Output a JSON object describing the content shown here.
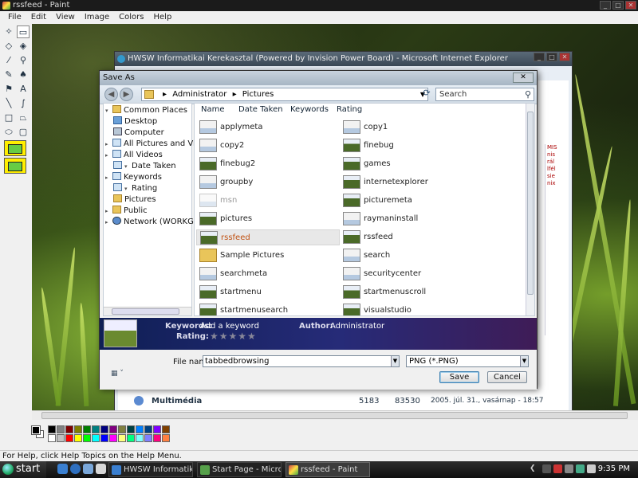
{
  "paint": {
    "title": "rssfeed - Paint",
    "menu": [
      "File",
      "Edit",
      "View",
      "Image",
      "Colors",
      "Help"
    ],
    "status_text": "For Help, click Help Topics on the Help Menu."
  },
  "ie": {
    "title": "HWSW Informatikai Kerekasztal (Powered by Invision Power Board) - Microsoft Internet Explorer",
    "forum_label": "Multimédia",
    "forum_stat1": "5183",
    "forum_stat2": "83530",
    "forum_date": "2005. júl. 31., vasárnap - 18:57"
  },
  "dialog": {
    "title": "Save As",
    "address_crumbs": [
      "Administrator",
      "Pictures"
    ],
    "search_placeholder": "Search",
    "tree": [
      {
        "label": "Common Places",
        "icon": "folder"
      },
      {
        "label": "Desktop",
        "icon": "desktop"
      },
      {
        "label": "Computer",
        "icon": "computer"
      },
      {
        "label": "All Pictures and Videos",
        "icon": "search-folder"
      },
      {
        "label": "All Videos",
        "icon": "search-folder"
      },
      {
        "label": "Date Taken",
        "icon": "search-folder"
      },
      {
        "label": "Keywords",
        "icon": "search-folder"
      },
      {
        "label": "Rating",
        "icon": "search-folder"
      },
      {
        "label": "Pictures",
        "icon": "folder"
      },
      {
        "label": "Public",
        "icon": "folder"
      },
      {
        "label": "Network (WORKGROUP",
        "icon": "network"
      }
    ],
    "columns": [
      "Name",
      "Date Taken",
      "Keywords",
      "Rating"
    ],
    "files_left": [
      "applymeta",
      "copy2",
      "finebug2",
      "groupby",
      "msn",
      "pictures",
      "rssfeed",
      "Sample Pictures",
      "searchmeta",
      "startmenu",
      "startmenusearch"
    ],
    "files_right": [
      "copy1",
      "finebug",
      "games",
      "internetexplorer",
      "picturemeta",
      "raymaninstall",
      "rssfeed",
      "search",
      "securitycenter",
      "startmenuscroll",
      "visualstudio"
    ],
    "selected_file": "rssfeed",
    "details": {
      "keywords_label": "Keywords:",
      "keywords_value": "Add a keyword",
      "rating_label": "Rating:",
      "author_label": "Author:",
      "author_value": "Administrator"
    },
    "filename_label": "File name:",
    "filename_value": "tabbedbrowsing",
    "filetype_value": "PNG (*.PNG)",
    "save_label": "Save",
    "cancel_label": "Cancel"
  },
  "taskbar": {
    "start_label": "start",
    "tasks": [
      "HWSW Informatikai ...",
      "Start Page - Microso...",
      "rssfeed - Paint"
    ],
    "clock": "9:35 PM"
  },
  "colors": {
    "palette": [
      "#000000",
      "#808080",
      "#800000",
      "#808000",
      "#008000",
      "#008080",
      "#000080",
      "#800080",
      "#808040",
      "#004040",
      "#0080ff",
      "#004080",
      "#8000ff",
      "#804000",
      "#ffffff",
      "#c0c0c0",
      "#ff0000",
      "#ffff00",
      "#00ff00",
      "#00ffff",
      "#0000ff",
      "#ff00ff",
      "#ffff80",
      "#00ff80",
      "#80ffff",
      "#8080ff",
      "#ff0080",
      "#ff8040"
    ]
  }
}
